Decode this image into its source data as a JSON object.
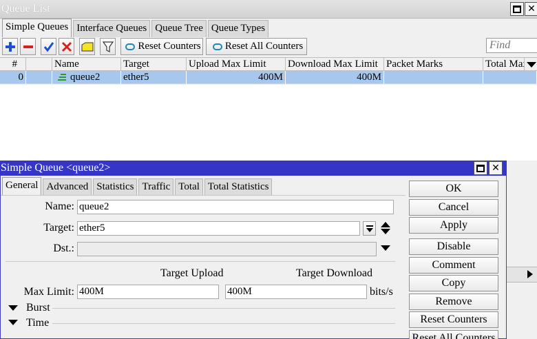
{
  "queue_list": {
    "title": "Queue List",
    "tabs": [
      "Simple Queues",
      "Interface Queues",
      "Queue Tree",
      "Queue Types"
    ],
    "toolbar": {
      "reset_counters": "Reset Counters",
      "reset_all_counters": "Reset All Counters",
      "find_placeholder": "Find"
    },
    "columns": [
      "#",
      "Name",
      "Target",
      "Upload Max Limit",
      "Download Max Limit",
      "Packet Marks",
      "Total Max"
    ],
    "rows": [
      {
        "num": "0",
        "name": "queue2",
        "target": "ether5",
        "upload_max": "400M",
        "download_max": "400M",
        "packet_marks": "",
        "total_max": ""
      }
    ]
  },
  "dialog": {
    "title": "Simple Queue <queue2>",
    "tabs": [
      "General",
      "Advanced",
      "Statistics",
      "Traffic",
      "Total",
      "Total Statistics"
    ],
    "fields": {
      "name_label": "Name:",
      "name_value": "queue2",
      "target_label": "Target:",
      "target_value": "ether5",
      "dst_label": "Dst.:",
      "dst_value": "",
      "target_upload_header": "Target Upload",
      "target_download_header": "Target Download",
      "max_limit_label": "Max Limit:",
      "max_limit_upload": "400M",
      "max_limit_download": "400M",
      "units": "bits/s",
      "burst_label": "Burst",
      "time_label": "Time"
    },
    "buttons": [
      "OK",
      "Cancel",
      "Apply",
      "Disable",
      "Comment",
      "Copy",
      "Remove",
      "Reset Counters",
      "Reset All Counters"
    ]
  },
  "colors": {
    "dialog_title_bg": "#3535c8",
    "selected_row": "#a7c8ec",
    "add_icon": "#1a4fd0",
    "remove_icon": "#d42020",
    "check_icon": "#1a4fd0",
    "cross_icon": "#d42020",
    "queue_icon": "#2b9a2b"
  }
}
